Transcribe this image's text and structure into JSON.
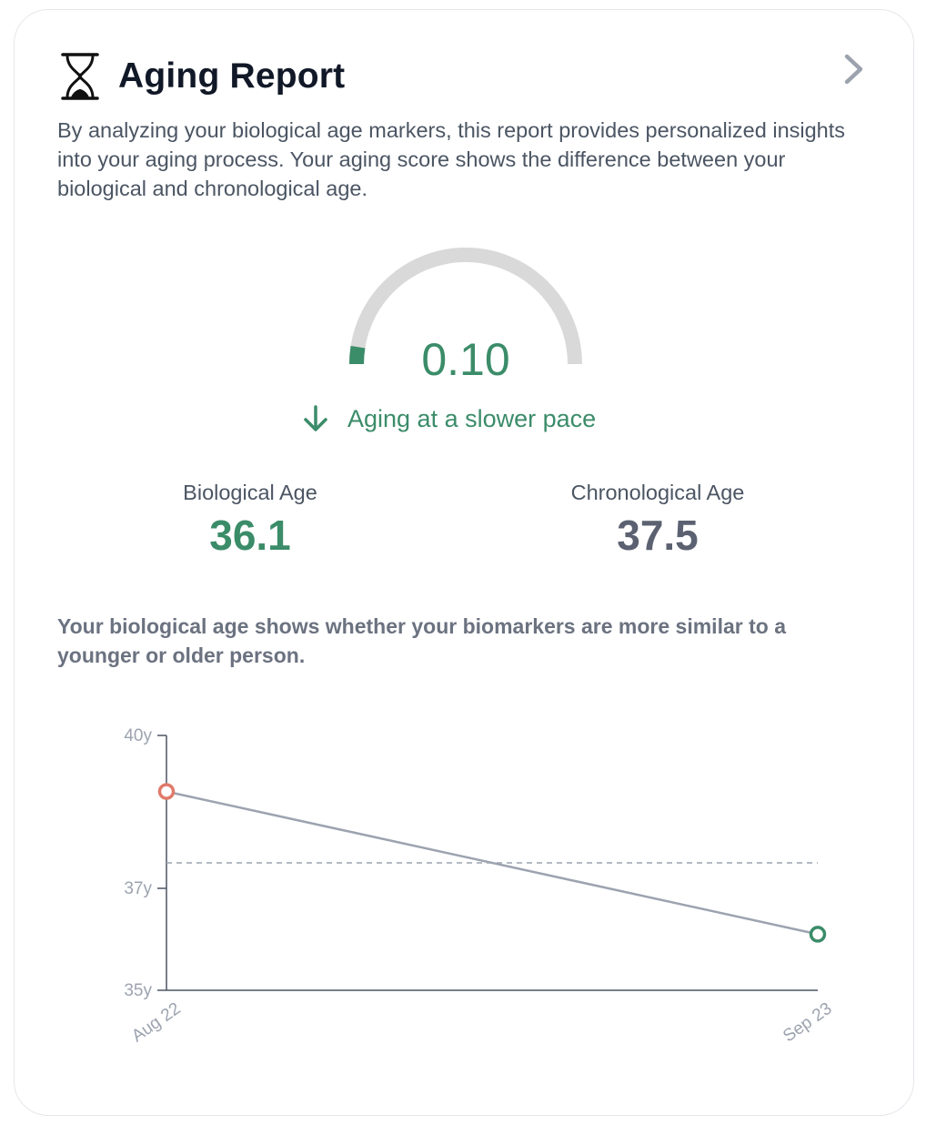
{
  "header": {
    "title": "Aging Report",
    "icon": "hourglass-icon",
    "chevron_icon": "chevron-right-icon"
  },
  "description": "By analyzing your biological age markers, this report provides personalized insights into your aging process. Your aging score shows the difference between your biological and chronological age.",
  "gauge": {
    "score": "0.10",
    "fill_fraction": 0.05,
    "fill_color": "#3b8c69",
    "track_color": "#d9d9d9"
  },
  "pace": {
    "icon": "arrow-down-icon",
    "label": "Aging at a slower pace"
  },
  "stats": {
    "biological": {
      "label": "Biological Age",
      "value": "36.1"
    },
    "chronological": {
      "label": "Chronological Age",
      "value": "37.5"
    }
  },
  "note": "Your biological age shows whether your biomarkers are more similar to a younger or older person.",
  "colors": {
    "accent_green": "#3b8c69",
    "start_point_red": "#e07a6a",
    "line_gray": "#9ca3af"
  },
  "chart_data": {
    "type": "line",
    "x": [
      "Aug 22",
      "Sep 23"
    ],
    "series": [
      {
        "values": [
          38.9,
          36.1
        ]
      }
    ],
    "reference_line": 37.5,
    "y_ticks": [
      {
        "value": 40,
        "label": "40y"
      },
      {
        "value": 37,
        "label": "37y"
      },
      {
        "value": 35,
        "label": "35y"
      }
    ],
    "ylim": [
      35,
      40
    ],
    "point_colors": [
      "#e07a6a",
      "#3b8c69"
    ]
  }
}
